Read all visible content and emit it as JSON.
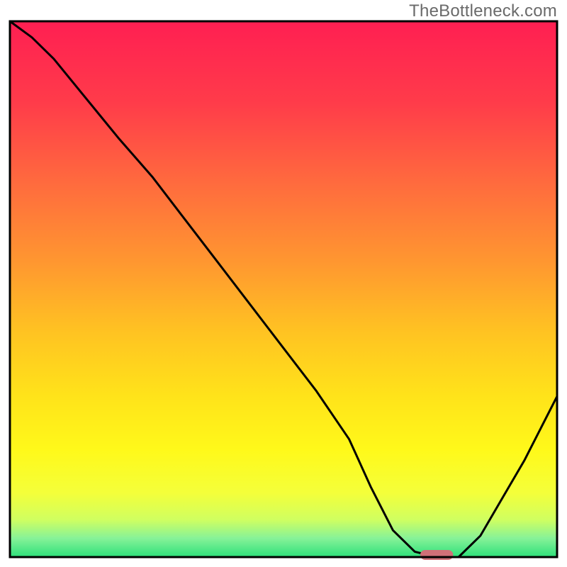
{
  "watermark": "TheBottleneck.com",
  "chart_data": {
    "type": "line",
    "title": "",
    "xlabel": "",
    "ylabel": "",
    "xlim": [
      0,
      100
    ],
    "ylim": [
      0,
      100
    ],
    "grid": false,
    "legend": false,
    "annotations": [],
    "series": [
      {
        "name": "bottleneck-curve",
        "x": [
          0,
          4,
          8,
          12,
          16,
          20,
          26,
          32,
          38,
          44,
          50,
          56,
          62,
          66,
          70,
          74,
          78,
          82,
          86,
          90,
          94,
          100
        ],
        "y": [
          100,
          97,
          93,
          88,
          83,
          78,
          71,
          63,
          55,
          47,
          39,
          31,
          22,
          13,
          5,
          1,
          0,
          0,
          4,
          11,
          18,
          30
        ]
      }
    ],
    "marker": {
      "name": "optimal-range",
      "x": 78,
      "y": 0,
      "width": 6,
      "color": "#d07078"
    },
    "gradient_stops": [
      {
        "offset": 0.0,
        "color": "#ff1f52"
      },
      {
        "offset": 0.15,
        "color": "#ff3b4a"
      },
      {
        "offset": 0.3,
        "color": "#ff6a3e"
      },
      {
        "offset": 0.45,
        "color": "#ff9730"
      },
      {
        "offset": 0.58,
        "color": "#ffc322"
      },
      {
        "offset": 0.7,
        "color": "#ffe31a"
      },
      {
        "offset": 0.8,
        "color": "#fff91a"
      },
      {
        "offset": 0.88,
        "color": "#f4ff3a"
      },
      {
        "offset": 0.93,
        "color": "#d0ff60"
      },
      {
        "offset": 0.965,
        "color": "#86f298"
      },
      {
        "offset": 1.0,
        "color": "#2de07a"
      }
    ],
    "frame_color": "#000000",
    "curve_color": "#000000"
  }
}
